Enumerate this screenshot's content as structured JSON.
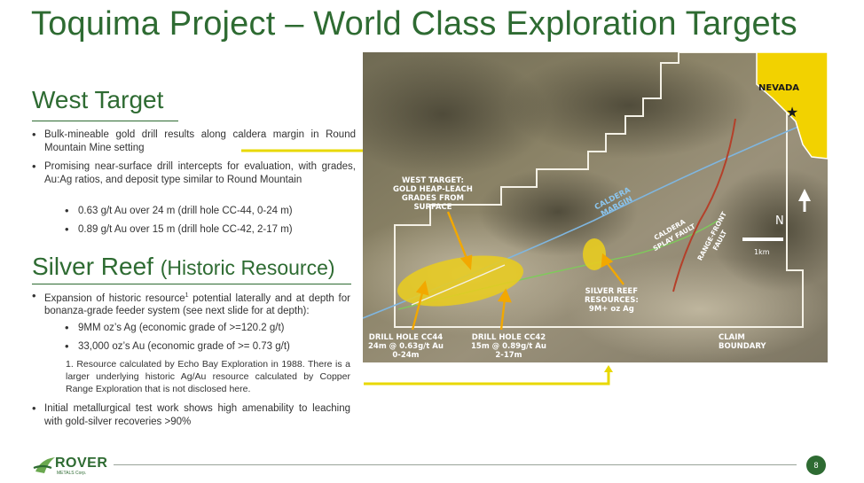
{
  "title": "Toquima Project – World Class Exploration Targets",
  "west": {
    "heading": "West Target",
    "bullets": [
      "Bulk-mineable gold drill results along caldera margin in Round Mountain Mine setting",
      "Promising near-surface drill intercepts for evaluation, with grades, Au:Ag ratios, and deposit type similar to Round Mountain"
    ],
    "sub_bullets": [
      "0.63 g/t Au over 24 m (drill hole CC-44, 0-24 m)",
      "0.89 g/t Au over 15 m (drill hole CC-42, 2-17 m)"
    ]
  },
  "silver": {
    "heading": "Silver Reef",
    "heading_sub": "(Historic Resource)",
    "bullet1": "Expansion of historic resource",
    "bullet1_sup": "1",
    "bullet1_rest": " potential laterally and at depth for bonanza-grade feeder system (see next slide for at depth):",
    "sub_bullets": [
      "9MM oz’s Ag (economic grade of >=120.2 g/t)",
      "33,000 oz’s Au (economic grade of >=  0.73 g/t)"
    ],
    "footnote": "1. Resource calculated by Echo Bay Exploration in 1988. There is a larger underlying historic Ag/Au resource calculated by Copper Range Exploration that is not disclosed here.",
    "bullet2": "Initial metallurgical test work shows high amenability to leaching with gold-silver recoveries >90%"
  },
  "map": {
    "nevada": "NEVADA",
    "north": "N",
    "scale": "1km",
    "west_target_label": [
      "WEST TARGET:",
      "GOLD HEAP-LEACH",
      "GRADES FROM",
      "SURFACE"
    ],
    "caldera_margin": [
      "CALDERA",
      "MARGIN"
    ],
    "caldera_splay": [
      "CALDERA",
      "SPLAY FAULT"
    ],
    "range_front": [
      "RANGE-FRONT",
      "FAULT"
    ],
    "silver_reef_label": [
      "SILVER REEF",
      "RESOURCES:",
      "9M+ oz Ag"
    ],
    "cc44_label": [
      "DRILL HOLE CC44",
      "24m @ 0.63g/t Au",
      "0-24m"
    ],
    "cc42_label": [
      "DRILL HOLE CC42",
      "15m @ 0.89g/t Au",
      "2-17m"
    ],
    "claim_label": [
      "CLAIM",
      "BOUNDARY"
    ]
  },
  "footer": {
    "logo": "ROVER",
    "logo_sub": "METALS Corp.",
    "page": "8"
  },
  "colors": {
    "brand_green": "#2e6b32",
    "callout_yellow": "#f2e200",
    "nevada_yellow": "#f2d200"
  }
}
